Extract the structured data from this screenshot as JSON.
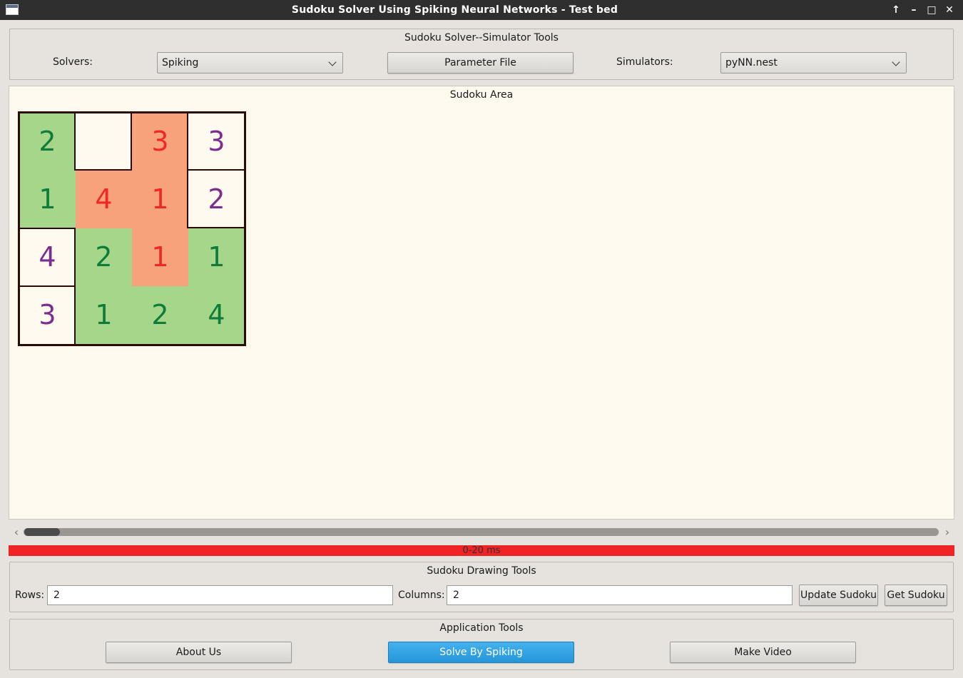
{
  "window": {
    "title": "Sudoku Solver Using Spiking Neural Networks - Test bed",
    "controls": [
      "↑",
      "–",
      "□",
      "✕"
    ]
  },
  "simulator_tools": {
    "title": "Sudoku Solver--Simulator Tools",
    "solvers_label": "Solvers:",
    "solver_value": "Spiking",
    "parameter_file_label": "Parameter File",
    "simulators_label": "Simulators:",
    "simulator_value": "pyNN.nest"
  },
  "sudoku_area": {
    "title": "Sudoku Area",
    "grid": [
      [
        {
          "v": "2",
          "k": "green"
        },
        {
          "v": "",
          "k": "given"
        },
        {
          "v": "3",
          "k": "orange"
        },
        {
          "v": "3",
          "k": "given"
        }
      ],
      [
        {
          "v": "1",
          "k": "green"
        },
        {
          "v": "4",
          "k": "orange"
        },
        {
          "v": "1",
          "k": "orange"
        },
        {
          "v": "2",
          "k": "given"
        }
      ],
      [
        {
          "v": "4",
          "k": "given"
        },
        {
          "v": "2",
          "k": "green"
        },
        {
          "v": "1",
          "k": "orange"
        },
        {
          "v": "1",
          "k": "green"
        }
      ],
      [
        {
          "v": "3",
          "k": "given"
        },
        {
          "v": "1",
          "k": "green"
        },
        {
          "v": "2",
          "k": "green"
        },
        {
          "v": "4",
          "k": "green"
        }
      ]
    ],
    "colors": {
      "given_text": "#7b2d8e",
      "green_text": "#0f7c3a",
      "orange_text": "#ee2828",
      "green_bg": "#a5d68a",
      "orange_bg": "#f8a27c"
    }
  },
  "progress": {
    "text": "0-20 ms",
    "fraction": 1.0,
    "color": "#ef2224"
  },
  "drawing_tools": {
    "title": "Sudoku Drawing Tools",
    "rows_label": "Rows:",
    "rows_value": "2",
    "columns_label": "Columns:",
    "columns_value": "2",
    "update_label": "Update Sudoku",
    "get_label": "Get Sudoku"
  },
  "app_tools": {
    "title": "Application Tools",
    "about_label": "About Us",
    "solve_label": "Solve By Spiking",
    "video_label": "Make Video"
  }
}
